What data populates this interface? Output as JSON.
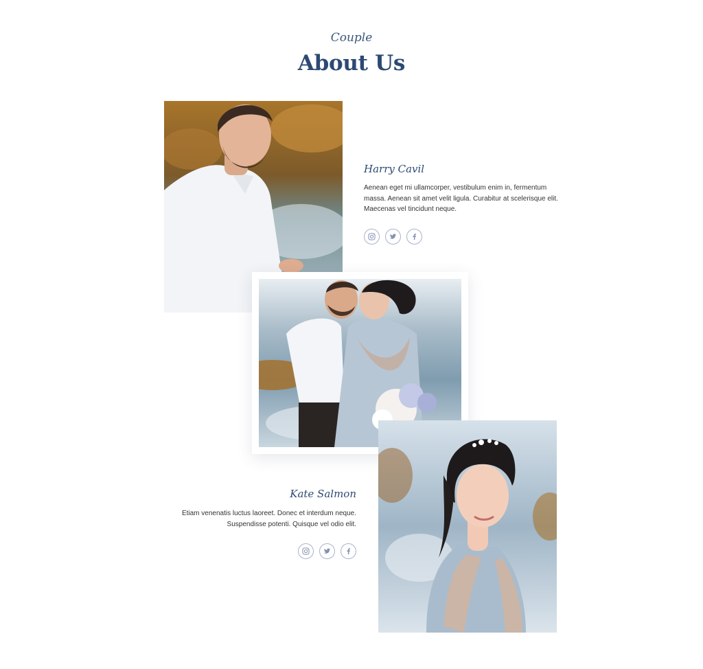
{
  "section": {
    "eyebrow": "Couple",
    "title": "About Us"
  },
  "groom": {
    "name": "Harry Cavil",
    "bio": "Aenean eget mi ullamcorper, vestibulum enim in, fermentum massa. Aenean sit amet velit ligula. Curabitur at scelerisque elit. Maecenas vel tincidunt neque.",
    "socials": [
      "instagram-icon",
      "twitter-icon",
      "facebook-icon"
    ]
  },
  "bride": {
    "name": "Kate Salmon",
    "bio": "Etiam venenatis luctus laoreet. Donec et interdum neque. Suspendisse potenti. Quisque vel odio elit.",
    "socials": [
      "instagram-icon",
      "twitter-icon",
      "facebook-icon"
    ]
  },
  "colors": {
    "heading": "#2c4a72",
    "social_border": "#a9b2cc",
    "social_icon": "#8591b4"
  }
}
